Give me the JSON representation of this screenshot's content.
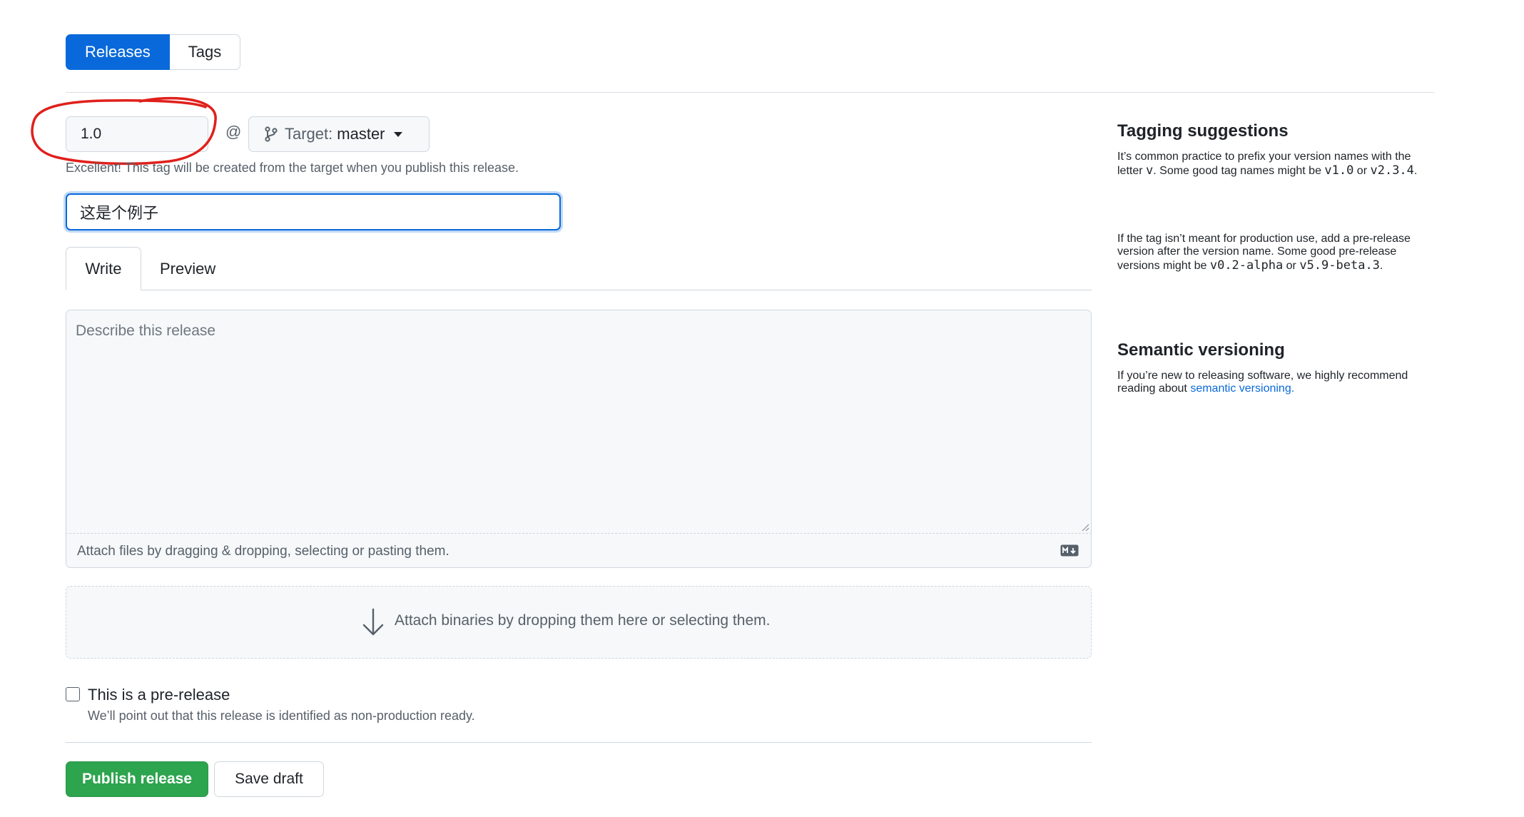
{
  "subnav": {
    "releases": "Releases",
    "tags": "Tags"
  },
  "tag": {
    "value": "1.0",
    "at": "@",
    "target_label": "Target:",
    "target_value": "master",
    "note": "Excellent! This tag will be created from the target when you publish this release."
  },
  "release_title": {
    "value": "这是个例子"
  },
  "editor": {
    "write_tab": "Write",
    "preview_tab": "Preview",
    "placeholder": "Describe this release",
    "attach_files": "Attach files by dragging & dropping, selecting or pasting them."
  },
  "binaries": {
    "text": "Attach binaries by dropping them here or selecting them."
  },
  "prerelease": {
    "label": "This is a pre-release",
    "desc": "We’ll point out that this release is identified as non-production ready.",
    "checked": false
  },
  "actions": {
    "publish": "Publish release",
    "save_draft": "Save draft"
  },
  "sidebar": {
    "tagging_title": "Tagging suggestions",
    "tagging_p1_a": "It’s common practice to prefix your version names with the letter ",
    "tagging_p1_code1": "v",
    "tagging_p1_b": ". Some good tag names might be ",
    "tagging_p1_code2": "v1.0",
    "tagging_p1_c": " or ",
    "tagging_p1_code3": "v2.3.4",
    "tagging_p1_d": ".",
    "tagging_p2_a": "If the tag isn’t meant for production use, add a pre-release version after the version name. Some good pre-release versions might be ",
    "tagging_p2_code1": "v0.2-alpha",
    "tagging_p2_b": " or ",
    "tagging_p2_code2": "v5.9-beta.3",
    "tagging_p2_c": ".",
    "semver_title": "Semantic versioning",
    "semver_p_a": "If you’re new to releasing software, we highly recommend reading about ",
    "semver_link": "semantic versioning",
    "semver_p_b": "."
  },
  "colors": {
    "primary": "#0969da",
    "success": "#2da44e",
    "annotation": "#e0201b",
    "border": "#d0d7de"
  }
}
